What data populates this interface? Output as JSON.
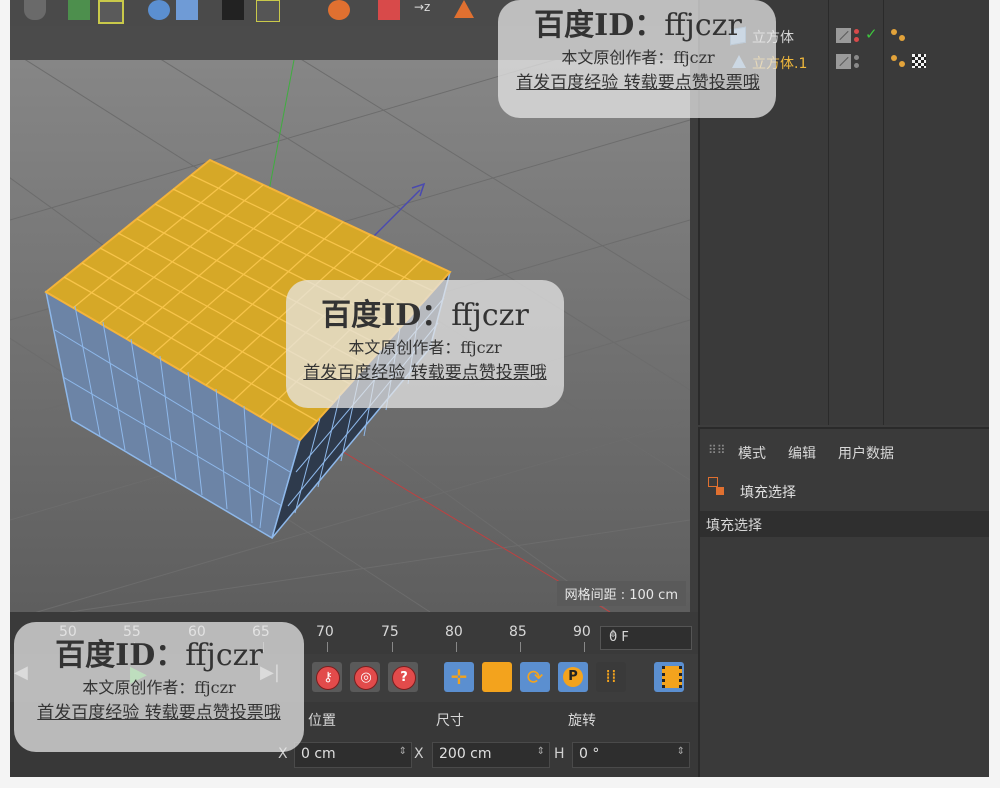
{
  "object_manager": {
    "objects": [
      {
        "name": "立方体",
        "selected": false
      },
      {
        "name": "立方体.1",
        "selected": true
      }
    ]
  },
  "viewport": {
    "grid_spacing_label": "网格间距 : 100 cm"
  },
  "attribute_manager": {
    "menu": [
      "模式",
      "编辑",
      "用户数据"
    ],
    "tag_title": "填充选择",
    "tab_label": "填充选择"
  },
  "timeline": {
    "ticks": [
      "50",
      "55",
      "60",
      "65",
      "70",
      "75",
      "80",
      "85",
      "90"
    ],
    "current_frame": "0 F"
  },
  "coordinates": {
    "headers": [
      "位置",
      "尺寸",
      "旋转"
    ],
    "fields": [
      {
        "axis": "X",
        "value": "0 cm"
      },
      {
        "axis": "X",
        "value": "200 cm"
      },
      {
        "axis": "H",
        "value": "0 °"
      }
    ]
  },
  "watermark": {
    "line1_brand": "百度ID：",
    "line1_id": "ffjczr",
    "line2": "本文原创作者：ffjczr",
    "line3": "首发百度经验 转载要点赞投票哦"
  },
  "colors": {
    "selection_orange": "#f3a31d",
    "polygon_blue": "#7fb0e0",
    "accent_blue": "#5b8fd0",
    "record_red": "#e24b4b"
  }
}
